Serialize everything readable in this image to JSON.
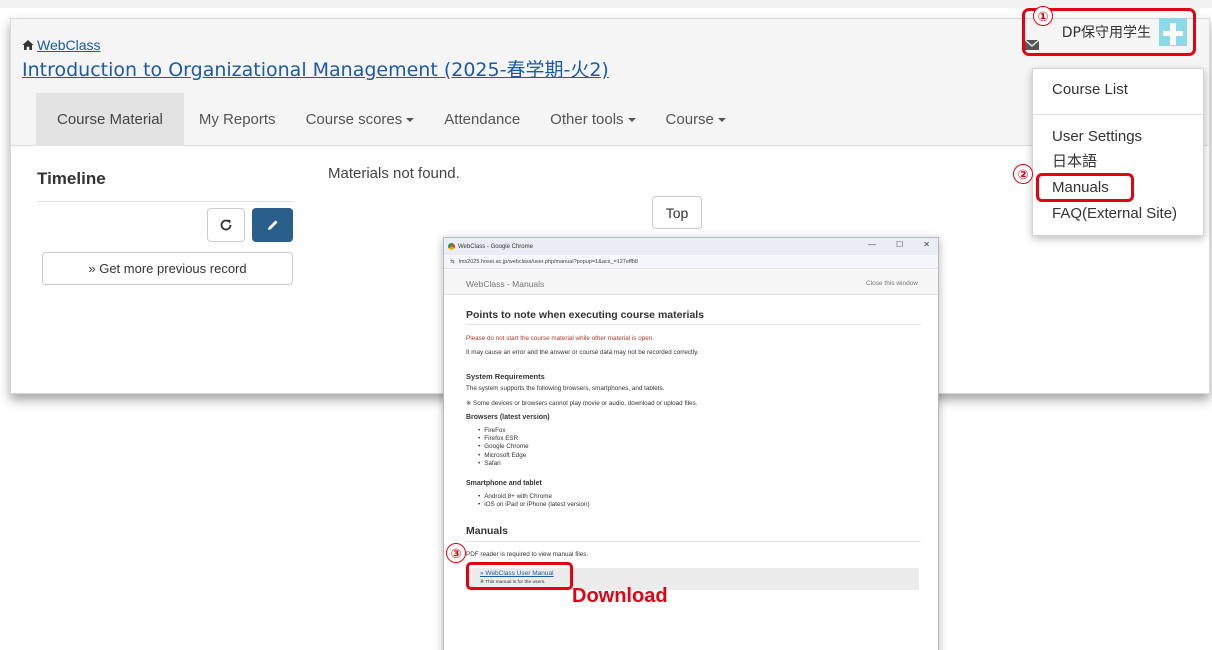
{
  "header": {
    "home_link": "WebClass",
    "course_title": "Introduction to Organizational Management (2025-春学期-火2)",
    "user_name": "DP保守用学生"
  },
  "nav": {
    "items": [
      {
        "label": "Course Material",
        "dropdown": false,
        "active": true
      },
      {
        "label": "My Reports",
        "dropdown": false,
        "active": false
      },
      {
        "label": "Course scores",
        "dropdown": true,
        "active": false
      },
      {
        "label": "Attendance",
        "dropdown": false,
        "active": false
      },
      {
        "label": "Other tools",
        "dropdown": true,
        "active": false
      },
      {
        "label": "Course",
        "dropdown": true,
        "active": false
      }
    ]
  },
  "timeline": {
    "title": "Timeline",
    "more_button": "» Get more previous record"
  },
  "main": {
    "empty_message": "Materials not found.",
    "top_button": "Top"
  },
  "user_dropdown": {
    "items": [
      "Course List",
      "User Settings",
      "日本語",
      "Manuals",
      "FAQ(External Site)"
    ]
  },
  "annotations": {
    "step1": "①",
    "step2": "②",
    "step3": "③",
    "download_label": "Download",
    "accent_color": "#e60012"
  },
  "popup": {
    "window_title": "WebClass - Google Chrome",
    "url": "lms2025.hosei.ac.jp/webclass/user.php/manual?popup=1&acs_=127effb8",
    "header_title": "WebClass - Manuals",
    "close_link": "Close this window",
    "heading": "Points to note when executing course materials",
    "warning": "Please do not start the course material while other material is open.",
    "warning_detail": "It may cause an error and the answer or course data may not be recorded correctly.",
    "sysreq_title": "System Requirements",
    "sysreq_text": "The system supports the following browsers, smartphones, and tablets.",
    "sysreq_note": "※ Some devices or browsers cannot play movie or audio, download or upload files.",
    "browsers_title": "Browsers (latest version)",
    "browsers": [
      "FireFox",
      "Firefox ESR",
      "Google Chrome",
      "Microsoft Edge",
      "Safari"
    ],
    "mobile_title": "Smartphone and tablet",
    "mobile": [
      "Android 8+ with Chrome",
      "iOS on iPad or iPhone (latest version)"
    ],
    "manuals_title": "Manuals",
    "manuals_text": "PDF reader is required to view manual files.",
    "manual_link": "» WebClass User Manual",
    "manual_note": "※ This manual is for the users."
  }
}
